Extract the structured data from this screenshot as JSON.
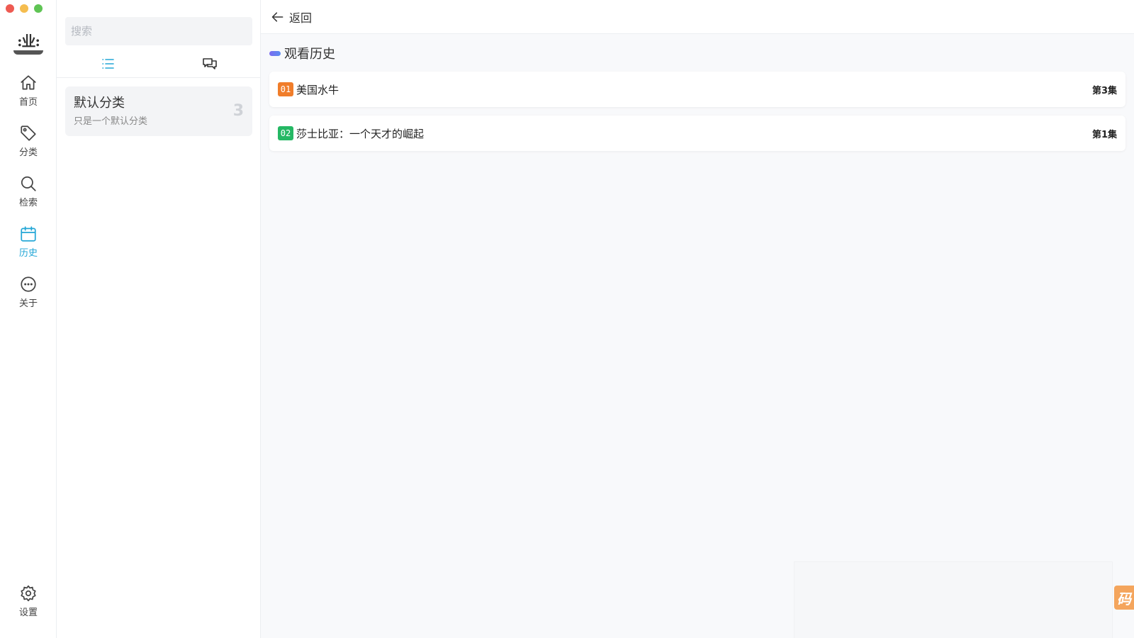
{
  "window": {
    "controls": [
      {
        "name": "close",
        "color": "#ee5a52"
      },
      {
        "name": "minimize",
        "color": "#f5bd4f"
      },
      {
        "name": "maximize",
        "color": "#5fc454"
      }
    ]
  },
  "logo": {
    "text": "业"
  },
  "nav": {
    "items": [
      {
        "id": "home",
        "label": "首页",
        "icon": "home-icon"
      },
      {
        "id": "category",
        "label": "分类",
        "icon": "tag-icon"
      },
      {
        "id": "search",
        "label": "检索",
        "icon": "search-icon"
      },
      {
        "id": "history",
        "label": "历史",
        "icon": "calendar-icon",
        "active": true
      },
      {
        "id": "about",
        "label": "关于",
        "icon": "more-circle-icon"
      }
    ],
    "settings": {
      "label": "设置",
      "icon": "gear-icon"
    }
  },
  "sidebar": {
    "search": {
      "placeholder": "搜索",
      "value": ""
    },
    "tabs": [
      {
        "id": "list",
        "icon": "list-icon",
        "active": true
      },
      {
        "id": "chat",
        "icon": "chat-bubbles-icon",
        "active": false
      }
    ],
    "categories": [
      {
        "name": "默认分类",
        "desc": "只是一个默认分类",
        "count": "3"
      }
    ]
  },
  "main": {
    "back_label": "返回",
    "section_title": "观看历史",
    "history": [
      {
        "index": "01",
        "index_color": "#f07d2a",
        "title": "美国水牛",
        "episode": "第3集"
      },
      {
        "index": "02",
        "index_color": "#25b864",
        "title": "莎士比亚：一个天才的崛起",
        "episode": "第1集"
      }
    ]
  },
  "corner_badge": {
    "text": "码"
  },
  "colors": {
    "accent": "#22a6d6"
  }
}
